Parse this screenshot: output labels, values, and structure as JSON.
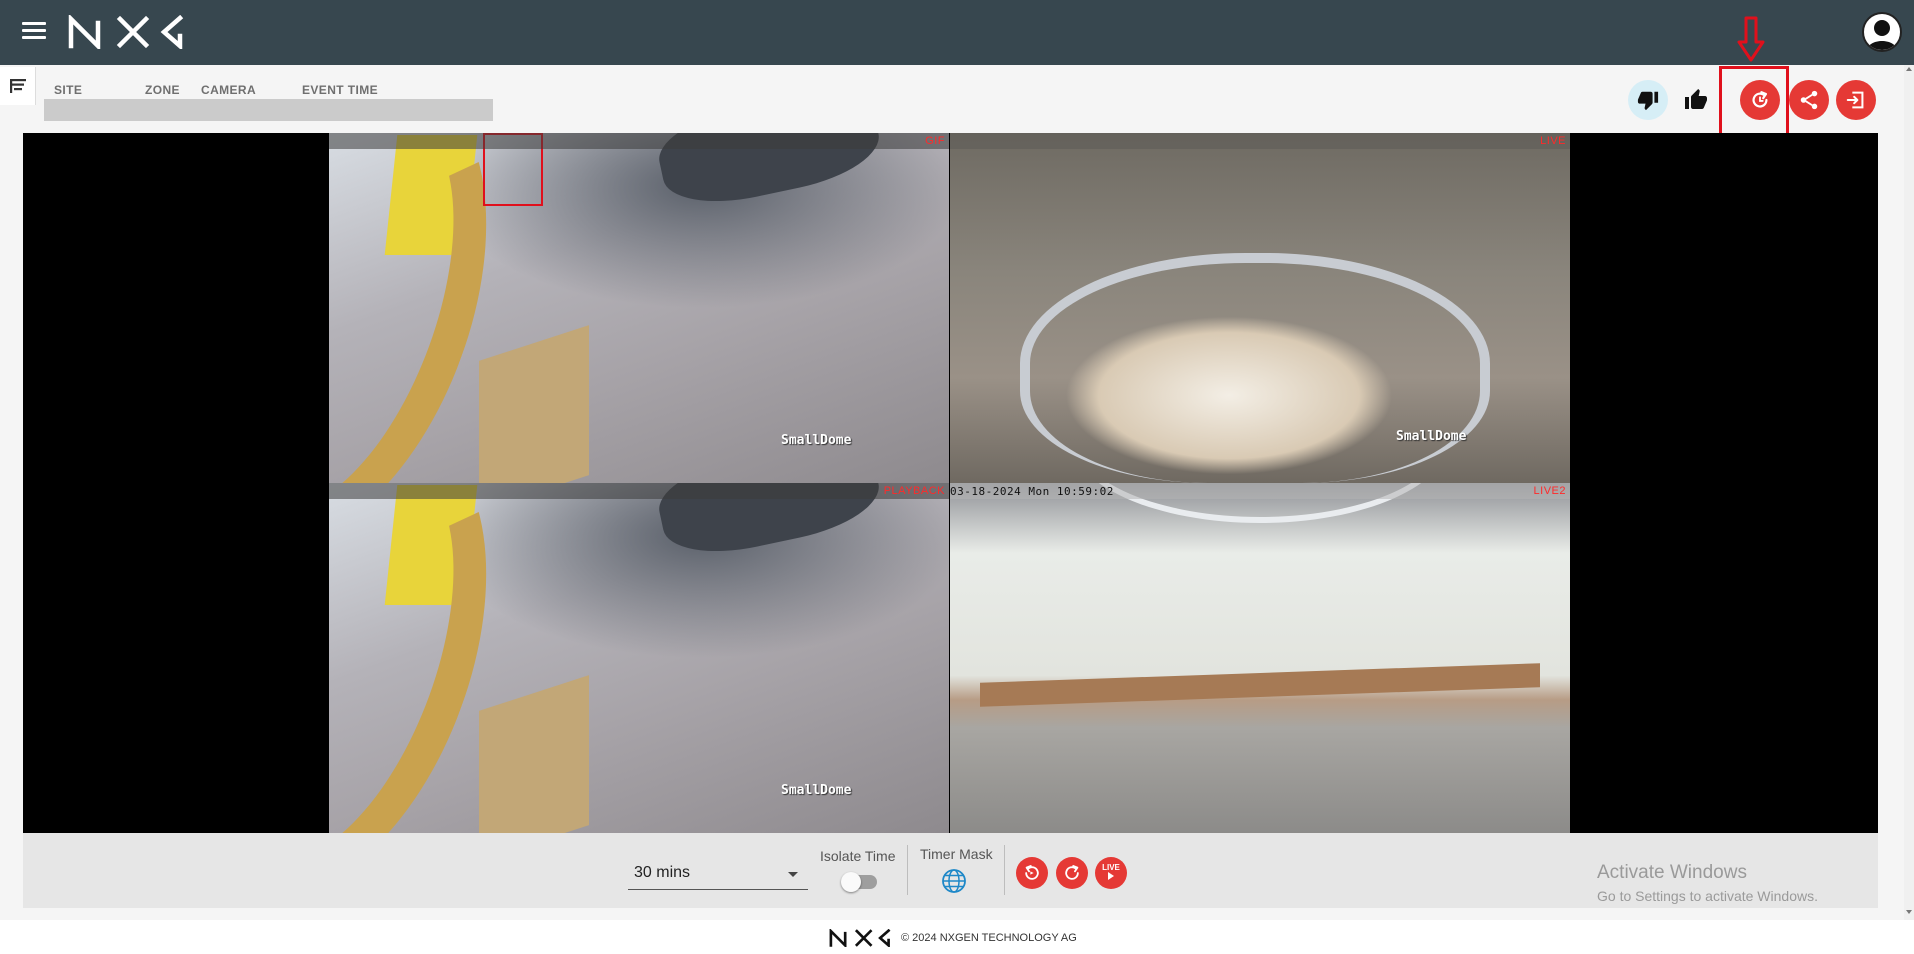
{
  "header": {
    "menu_icon": "hamburger-menu-icon",
    "logo_icon": "nxg-logo",
    "avatar_icon": "user-avatar-icon"
  },
  "event_meta": {
    "filter_icon": "filter-list-icon",
    "labels": {
      "site": "SITE",
      "zone": "ZONE",
      "camera": "CAMERA",
      "event_time": "EVENT TIME"
    }
  },
  "actions": {
    "dislike_icon": "thumbs-down-icon",
    "like_icon": "thumbs-up-icon",
    "replay_icon": "replay-icon",
    "share_icon": "share-icon",
    "exit_icon": "exit-icon",
    "accent_color": "#e53935",
    "highlight_color": "#e0101c"
  },
  "video_grid": {
    "tiles": [
      {
        "tag": "GIF",
        "cam_label": "SmallDome"
      },
      {
        "tag": "LIVE",
        "cam_label": "SmallDome"
      },
      {
        "tag": "PLAYBACK",
        "cam_label": "SmallDome"
      },
      {
        "tag": "LIVE2",
        "timestamp": "03-18-2024 Mon 10:59:02"
      }
    ]
  },
  "controls": {
    "duration_value": "30 mins",
    "isolate_time_label": "Isolate Time",
    "isolate_time_on": false,
    "timer_mask_label": "Timer Mask",
    "timer_mask_icon": "globe-icon",
    "buttons": {
      "rewind_icon": "rewind-icon",
      "reload_icon": "refresh-icon",
      "live_label": "LIVE"
    }
  },
  "watermark": {
    "line1": "Activate Windows",
    "line2": "Go to Settings to activate Windows."
  },
  "footer": {
    "copyright": "© 2024 NXGEN TECHNOLOGY AG"
  }
}
